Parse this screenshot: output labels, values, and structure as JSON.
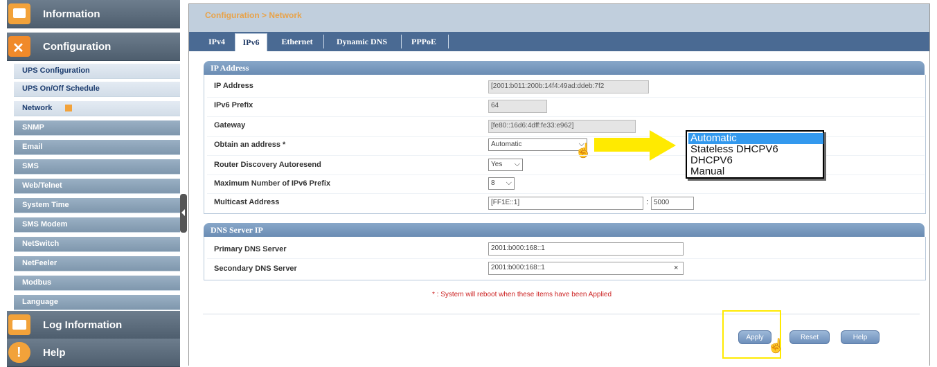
{
  "sidebar": {
    "sections": [
      {
        "label": "Information",
        "icon": "information-icon"
      },
      {
        "label": "Configuration",
        "icon": "tools-icon"
      },
      {
        "label": "Log Information",
        "icon": "folder-icon"
      },
      {
        "label": "Help",
        "icon": "help-icon"
      }
    ],
    "items": [
      {
        "label": "UPS Configuration"
      },
      {
        "label": "UPS On/Off Schedule"
      },
      {
        "label": "Network"
      },
      {
        "label": "SNMP"
      },
      {
        "label": "Email"
      },
      {
        "label": "SMS"
      },
      {
        "label": "Web/Telnet"
      },
      {
        "label": "System Time"
      },
      {
        "label": "SMS Modem"
      },
      {
        "label": "NetSwitch"
      },
      {
        "label": "NetFeeler"
      },
      {
        "label": "Modbus"
      },
      {
        "label": "Language"
      }
    ]
  },
  "breadcrumb": "Configuration > Network",
  "tabs": [
    "IPv4",
    "IPv6",
    "Ethernet",
    "Dynamic DNS",
    "PPPoE"
  ],
  "active_tab": "IPv6",
  "ip_panel": {
    "title": "IP Address",
    "ip_address_label": "IP Address",
    "ip_address_value": "[2001:b011:200b:14f4:49ad:ddeb:7f2",
    "prefix_label": "IPv6 Prefix",
    "prefix_value": "64",
    "gateway_label": "Gateway",
    "gateway_value": "[fe80::16d6:4dff:fe33:e962]",
    "obtain_label": "Obtain an address *",
    "obtain_value": "Automatic",
    "router_label": "Router Discovery Autoresend",
    "router_value": "Yes",
    "max_prefix_label": "Maximum Number of IPv6 Prefix",
    "max_prefix_value": "8",
    "multicast_label": "Multicast Address",
    "multicast_value": "[FF1E::1]",
    "multicast_port_sep": ":",
    "multicast_port": "5000"
  },
  "dropdown": {
    "options": [
      "Automatic",
      "Stateless DHCPV6",
      "DHCPV6",
      "Manual"
    ],
    "selected": "Automatic"
  },
  "dns_panel": {
    "title": "DNS Server IP",
    "primary_label": "Primary DNS Server",
    "primary_value": "2001:b000:168::1",
    "secondary_label": "Secondary DNS Server",
    "secondary_value": "2001:b000:168::1",
    "clear_symbol": "×"
  },
  "note": "* : System will reboot when these items have been Applied",
  "buttons": {
    "apply": "Apply",
    "reset": "Reset",
    "help": "Help"
  },
  "colors": {
    "highlight": "#ffea00",
    "accent": "#4a6a93",
    "selected_option": "#3399ee"
  }
}
